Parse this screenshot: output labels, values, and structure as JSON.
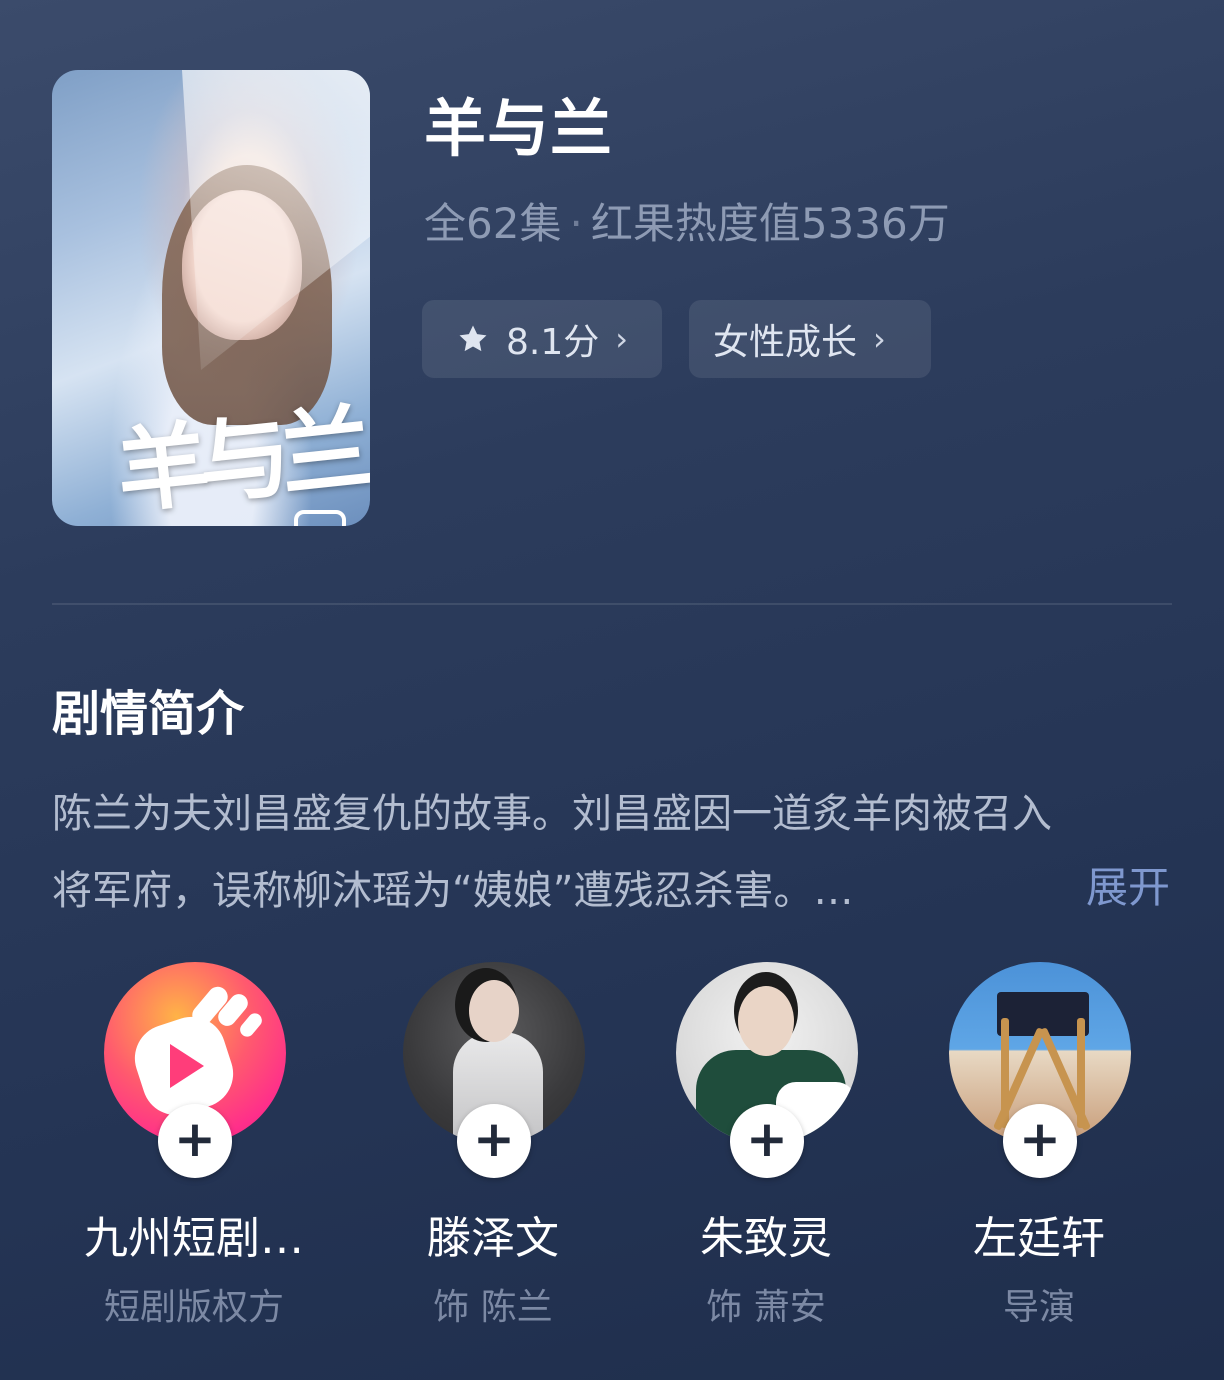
{
  "drama": {
    "title": "羊与兰",
    "episodes": "全62集",
    "heat": "红果热度值5336万",
    "rating_label": "8.1分",
    "tag_label": "女性成长",
    "chevron": "›",
    "poster_logo": "羊与兰"
  },
  "synopsis": {
    "heading": "剧情简介",
    "text": "陈兰为夫刘昌盛复仇的故事。刘昌盛因一道炙羊肉被召入将军府，误称柳沐瑶为“姨娘”遭残忍杀害。…",
    "expand_label": "展开"
  },
  "people": [
    {
      "name": "九州短剧…",
      "role": "短剧版权方",
      "avatar": "brand-logo-icon"
    },
    {
      "name": "滕泽文",
      "role": "饰 陈兰",
      "avatar": "actress-photo"
    },
    {
      "name": "朱致灵",
      "role": "饰 萧安",
      "avatar": "actor-photo"
    },
    {
      "name": "左廷轩",
      "role": "导演",
      "avatar": "director-chair-photo"
    }
  ],
  "follow_symbol": "+",
  "colors": {
    "accent_link": "#7f98cf",
    "subtle_text": "#8e9bb4",
    "brand_gradient": [
      "#ffb347",
      "#ff2f8a"
    ]
  }
}
